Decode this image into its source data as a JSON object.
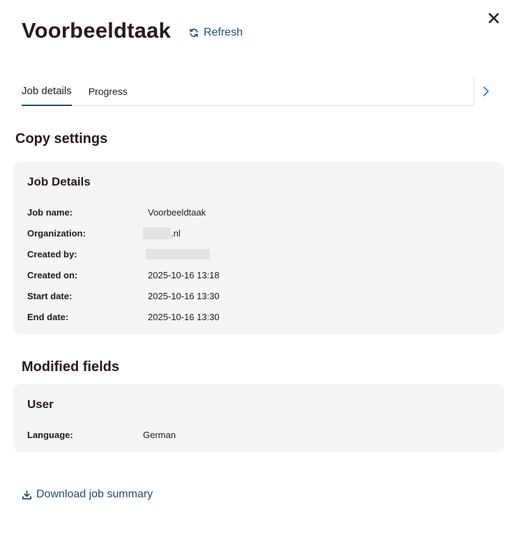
{
  "header": {
    "title": "Voorbeeldtaak",
    "refresh_label": "Refresh"
  },
  "tabs": [
    {
      "label": "Job details",
      "active": true
    },
    {
      "label": "Progress",
      "active": false
    }
  ],
  "copy_settings": {
    "title": "Copy settings",
    "job_details": {
      "title": "Job Details",
      "rows": [
        {
          "label": "Job name:",
          "value": "Voorbeeldtaak"
        },
        {
          "label": "Organization:",
          "value": ".nl"
        },
        {
          "label": "Created by:",
          "value": ""
        },
        {
          "label": "Created on:",
          "value": "2025-10-16 13:18"
        },
        {
          "label": "Start date:",
          "value": "2025-10-16 13:30"
        },
        {
          "label": "End date:",
          "value": "2025-10-16 13:30"
        }
      ]
    }
  },
  "modified_fields": {
    "title": "Modified fields",
    "user": {
      "title": "User",
      "rows": [
        {
          "label": "Language:",
          "value": "German"
        }
      ]
    }
  },
  "footer": {
    "download_label": "Download job summary"
  },
  "colors": {
    "accent": "#1f4f6e",
    "link_blue": "#2f7fc1",
    "card_bg": "#f4f5f7",
    "title_text": "#2a1a1c"
  },
  "icons": {
    "close": "close-icon",
    "refresh": "refresh-icon",
    "next": "chevron-right-icon",
    "download": "download-icon"
  }
}
